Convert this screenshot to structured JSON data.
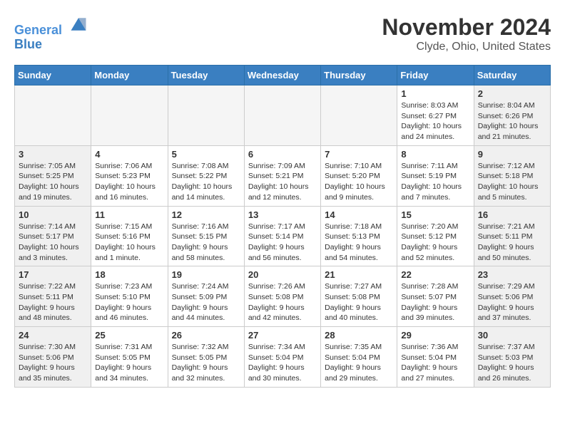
{
  "header": {
    "logo_line1": "General",
    "logo_line2": "Blue",
    "month_title": "November 2024",
    "location": "Clyde, Ohio, United States"
  },
  "weekdays": [
    "Sunday",
    "Monday",
    "Tuesday",
    "Wednesday",
    "Thursday",
    "Friday",
    "Saturday"
  ],
  "weeks": [
    [
      {
        "day": "",
        "info": ""
      },
      {
        "day": "",
        "info": ""
      },
      {
        "day": "",
        "info": ""
      },
      {
        "day": "",
        "info": ""
      },
      {
        "day": "",
        "info": ""
      },
      {
        "day": "1",
        "info": "Sunrise: 8:03 AM\nSunset: 6:27 PM\nDaylight: 10 hours\nand 24 minutes."
      },
      {
        "day": "2",
        "info": "Sunrise: 8:04 AM\nSunset: 6:26 PM\nDaylight: 10 hours\nand 21 minutes."
      }
    ],
    [
      {
        "day": "3",
        "info": "Sunrise: 7:05 AM\nSunset: 5:25 PM\nDaylight: 10 hours\nand 19 minutes."
      },
      {
        "day": "4",
        "info": "Sunrise: 7:06 AM\nSunset: 5:23 PM\nDaylight: 10 hours\nand 16 minutes."
      },
      {
        "day": "5",
        "info": "Sunrise: 7:08 AM\nSunset: 5:22 PM\nDaylight: 10 hours\nand 14 minutes."
      },
      {
        "day": "6",
        "info": "Sunrise: 7:09 AM\nSunset: 5:21 PM\nDaylight: 10 hours\nand 12 minutes."
      },
      {
        "day": "7",
        "info": "Sunrise: 7:10 AM\nSunset: 5:20 PM\nDaylight: 10 hours\nand 9 minutes."
      },
      {
        "day": "8",
        "info": "Sunrise: 7:11 AM\nSunset: 5:19 PM\nDaylight: 10 hours\nand 7 minutes."
      },
      {
        "day": "9",
        "info": "Sunrise: 7:12 AM\nSunset: 5:18 PM\nDaylight: 10 hours\nand 5 minutes."
      }
    ],
    [
      {
        "day": "10",
        "info": "Sunrise: 7:14 AM\nSunset: 5:17 PM\nDaylight: 10 hours\nand 3 minutes."
      },
      {
        "day": "11",
        "info": "Sunrise: 7:15 AM\nSunset: 5:16 PM\nDaylight: 10 hours\nand 1 minute."
      },
      {
        "day": "12",
        "info": "Sunrise: 7:16 AM\nSunset: 5:15 PM\nDaylight: 9 hours\nand 58 minutes."
      },
      {
        "day": "13",
        "info": "Sunrise: 7:17 AM\nSunset: 5:14 PM\nDaylight: 9 hours\nand 56 minutes."
      },
      {
        "day": "14",
        "info": "Sunrise: 7:18 AM\nSunset: 5:13 PM\nDaylight: 9 hours\nand 54 minutes."
      },
      {
        "day": "15",
        "info": "Sunrise: 7:20 AM\nSunset: 5:12 PM\nDaylight: 9 hours\nand 52 minutes."
      },
      {
        "day": "16",
        "info": "Sunrise: 7:21 AM\nSunset: 5:11 PM\nDaylight: 9 hours\nand 50 minutes."
      }
    ],
    [
      {
        "day": "17",
        "info": "Sunrise: 7:22 AM\nSunset: 5:11 PM\nDaylight: 9 hours\nand 48 minutes."
      },
      {
        "day": "18",
        "info": "Sunrise: 7:23 AM\nSunset: 5:10 PM\nDaylight: 9 hours\nand 46 minutes."
      },
      {
        "day": "19",
        "info": "Sunrise: 7:24 AM\nSunset: 5:09 PM\nDaylight: 9 hours\nand 44 minutes."
      },
      {
        "day": "20",
        "info": "Sunrise: 7:26 AM\nSunset: 5:08 PM\nDaylight: 9 hours\nand 42 minutes."
      },
      {
        "day": "21",
        "info": "Sunrise: 7:27 AM\nSunset: 5:08 PM\nDaylight: 9 hours\nand 40 minutes."
      },
      {
        "day": "22",
        "info": "Sunrise: 7:28 AM\nSunset: 5:07 PM\nDaylight: 9 hours\nand 39 minutes."
      },
      {
        "day": "23",
        "info": "Sunrise: 7:29 AM\nSunset: 5:06 PM\nDaylight: 9 hours\nand 37 minutes."
      }
    ],
    [
      {
        "day": "24",
        "info": "Sunrise: 7:30 AM\nSunset: 5:06 PM\nDaylight: 9 hours\nand 35 minutes."
      },
      {
        "day": "25",
        "info": "Sunrise: 7:31 AM\nSunset: 5:05 PM\nDaylight: 9 hours\nand 34 minutes."
      },
      {
        "day": "26",
        "info": "Sunrise: 7:32 AM\nSunset: 5:05 PM\nDaylight: 9 hours\nand 32 minutes."
      },
      {
        "day": "27",
        "info": "Sunrise: 7:34 AM\nSunset: 5:04 PM\nDaylight: 9 hours\nand 30 minutes."
      },
      {
        "day": "28",
        "info": "Sunrise: 7:35 AM\nSunset: 5:04 PM\nDaylight: 9 hours\nand 29 minutes."
      },
      {
        "day": "29",
        "info": "Sunrise: 7:36 AM\nSunset: 5:04 PM\nDaylight: 9 hours\nand 27 minutes."
      },
      {
        "day": "30",
        "info": "Sunrise: 7:37 AM\nSunset: 5:03 PM\nDaylight: 9 hours\nand 26 minutes."
      }
    ]
  ]
}
